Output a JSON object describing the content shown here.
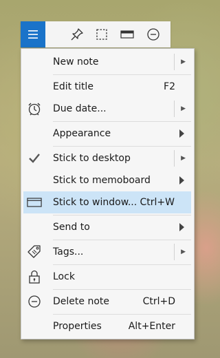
{
  "toolbar": {
    "icons": [
      "hamburger-menu-icon",
      "pin-icon",
      "dashed-frame-icon",
      "title-bar-icon",
      "minus-circle-icon"
    ],
    "accent": "#1a73c9"
  },
  "menu": {
    "items": [
      {
        "label": "New note",
        "shortcut": "",
        "submenu": "split"
      },
      {
        "label": "Edit title",
        "shortcut": "F2"
      },
      {
        "label": "Due date...",
        "shortcut": "",
        "submenu": "split",
        "icon": "alarm-clock-icon"
      },
      {
        "label": "Appearance",
        "shortcut": "",
        "submenu": "arrow"
      },
      {
        "label": "Stick to desktop",
        "shortcut": "",
        "submenu": "split",
        "icon": "checkmark-icon",
        "checked": true
      },
      {
        "label": "Stick to memoboard",
        "shortcut": "",
        "submenu": "arrow"
      },
      {
        "label": "Stick to window...",
        "shortcut": "Ctrl+W",
        "icon": "window-icon",
        "highlighted": true
      },
      {
        "label": "Send to",
        "shortcut": "",
        "submenu": "arrow"
      },
      {
        "label": "Tags...",
        "shortcut": "",
        "submenu": "split",
        "icon": "tag-icon"
      },
      {
        "label": "Lock",
        "shortcut": "",
        "icon": "padlock-icon"
      },
      {
        "label": "Delete note",
        "shortcut": "Ctrl+D",
        "icon": "minus-circle-icon"
      },
      {
        "label": "Properties",
        "shortcut": "Alt+Enter"
      }
    ],
    "highlight_color": "#cce4f7"
  }
}
